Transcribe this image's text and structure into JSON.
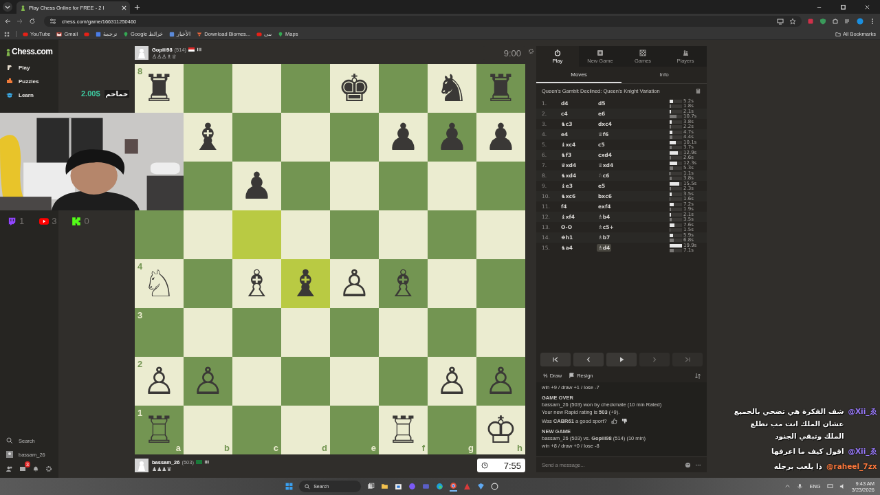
{
  "browser": {
    "tab_title": "Play Chess Online for FREE - 2 I",
    "url": "chess.com/game/166311250460",
    "bookmarks": [
      {
        "label": "YouTube",
        "kind": "youtube"
      },
      {
        "label": "Gmail",
        "kind": "gmail"
      },
      {
        "kind": "youtube"
      },
      {
        "label": "ترجمة",
        "kind": "translate"
      },
      {
        "label": "Google خرائط",
        "kind": "maps"
      },
      {
        "label": "الأخبار",
        "kind": "news"
      },
      {
        "label": "Download Biomes...",
        "kind": "download"
      },
      {
        "label": "ىىى",
        "kind": "youtube"
      },
      {
        "label": "Maps",
        "kind": "maps"
      }
    ],
    "all_bookmarks": "All Bookmarks"
  },
  "sidebar": {
    "logo": "Chess.com",
    "items": [
      {
        "label": "Play",
        "kind": "play"
      },
      {
        "label": "Puzzles",
        "kind": "puzzles"
      },
      {
        "label": "Learn",
        "kind": "learn"
      }
    ],
    "search": "Search",
    "user": "bassam_26",
    "mail_badge": "3"
  },
  "stream": {
    "donation_amount": "2.00$",
    "donation_name": "خماخم",
    "counts": [
      {
        "kind": "twitch",
        "count": "1"
      },
      {
        "kind": "youtube",
        "count": "3"
      },
      {
        "kind": "kick",
        "count": "0"
      }
    ],
    "chat": [
      {
        "user": "@Xii_ゑ",
        "color": "#9b7bff",
        "message": "شف الفكرة هي تضحي بالجميع عشان الملك انت مب تطلع الملك وتبقي الجنود"
      },
      {
        "user": "@Xii_ゑ",
        "color": "#9b7bff",
        "message": "اقول كيف ما اعرفها"
      },
      {
        "user": "@raheel_7zx",
        "color": "#ff7a3d",
        "message": "ذا يلعب برجله"
      }
    ]
  },
  "game": {
    "top_player": {
      "name": "Gopiii98",
      "rating": "(514)",
      "captured": "♙♙♙♗♕",
      "clock": "9:00",
      "active": false
    },
    "bottom_player": {
      "name": "bassam_26",
      "rating": "(503)",
      "captured": "♟♟♟♛",
      "clock": "7:55",
      "active": true
    },
    "board": {
      "files": [
        "a",
        "b",
        "c",
        "d",
        "e",
        "f",
        "g",
        "h"
      ],
      "ranks": [
        {
          "label": "8",
          "cells": [
            {
              "piece": "♜",
              "highlighted": false
            },
            {
              "highlighted": false
            },
            {
              "highlighted": false
            },
            {
              "highlighted": false
            },
            {
              "piece": "♚",
              "highlighted": false
            },
            {
              "highlighted": false
            },
            {
              "piece": "♞",
              "highlighted": false
            },
            {
              "piece": "♜",
              "highlighted": false
            }
          ]
        },
        {
          "cells": [
            {},
            {
              "piece": "♝",
              "highlighted": false
            },
            {
              "highlighted": false
            },
            {
              "highlighted": false
            },
            {
              "highlighted": false
            },
            {
              "piece": "♟",
              "highlighted": false
            },
            {
              "piece": "♟",
              "highlighted": false
            },
            {
              "piece": "♟",
              "highlighted": false
            }
          ]
        },
        {
          "cells": [
            {},
            {
              "highlighted": false
            },
            {
              "piece": "♟",
              "highlighted": false
            },
            {
              "highlighted": false
            },
            {
              "highlighted": false
            },
            {
              "highlighted": false
            },
            {
              "highlighted": false
            },
            {
              "highlighted": false
            }
          ]
        },
        {
          "cells": [
            {
              "highlighted": false
            },
            {
              "highlighted": false
            },
            {
              "highlighted": true
            },
            {
              "highlighted": false
            },
            {
              "highlighted": false
            },
            {
              "highlighted": false
            },
            {
              "highlighted": false
            },
            {
              "highlighted": false
            }
          ]
        },
        {
          "label": "4",
          "cells": [
            {
              "piece": "♘",
              "highlighted": false
            },
            {
              "highlighted": false
            },
            {
              "piece": "♗",
              "highlighted": false
            },
            {
              "piece": "♝",
              "highlighted": true
            },
            {
              "piece": "♙",
              "highlighted": false
            },
            {
              "piece": "♗",
              "highlighted": false
            },
            {
              "highlighted": false
            },
            {
              "highlighted": false
            }
          ]
        },
        {
          "label": "3",
          "cells": [
            {
              "highlighted": false
            },
            {
              "highlighted": false
            },
            {
              "highlighted": false
            },
            {
              "highlighted": false
            },
            {
              "highlighted": false
            },
            {
              "highlighted": false
            },
            {
              "highlighted": false
            },
            {
              "highlighted": false
            }
          ]
        },
        {
          "label": "2",
          "cells": [
            {
              "piece": "♙",
              "highlighted": false
            },
            {
              "piece": "♙",
              "highlighted": false
            },
            {
              "highlighted": false
            },
            {
              "highlighted": false
            },
            {
              "highlighted": false
            },
            {
              "highlighted": false
            },
            {
              "piece": "♙",
              "highlighted": false
            },
            {
              "piece": "♙",
              "highlighted": false
            }
          ]
        },
        {
          "label": "1",
          "cells": [
            {
              "piece": "♖",
              "highlighted": false
            },
            {
              "highlighted": false
            },
            {
              "highlighted": false
            },
            {
              "highlighted": false
            },
            {
              "highlighted": false
            },
            {
              "piece": "♖",
              "highlighted": false
            },
            {
              "highlighted": false
            },
            {
              "piece": "♔",
              "highlighted": false
            }
          ]
        }
      ]
    }
  },
  "panel": {
    "tabs": [
      {
        "label": "Play",
        "kind": "play",
        "selected": true
      },
      {
        "label": "New Game",
        "kind": "new",
        "selected": false
      },
      {
        "label": "Games",
        "kind": "games",
        "selected": false
      },
      {
        "label": "Players",
        "kind": "players",
        "selected": false
      }
    ],
    "subtabs": [
      {
        "label": "Moves",
        "selected": true
      },
      {
        "label": "Info",
        "selected": false
      }
    ],
    "opening": "Queen's Gambit Declined: Queen's Knight Variation",
    "moves": [
      {
        "number": "1.",
        "white": {
          "text": "d4",
          "time": "5.2s",
          "level": 0.26,
          "selected": false
        },
        "black": {
          "text": "d5",
          "time": "1.8s",
          "level": 0.09,
          "selected": false
        }
      },
      {
        "number": "2.",
        "white": {
          "text": "c4",
          "time": "2.1s",
          "level": 0.11,
          "selected": false
        },
        "black": {
          "text": "e6",
          "time": "10.7s",
          "level": 0.54,
          "selected": false
        }
      },
      {
        "number": "3.",
        "white": {
          "text": "♞c3",
          "time": "3.8s",
          "level": 0.19,
          "selected": false
        },
        "black": {
          "text": "dxc4",
          "time": "2.2s",
          "level": 0.11,
          "selected": false
        }
      },
      {
        "number": "4.",
        "white": {
          "text": "e4",
          "time": "4.7s",
          "level": 0.24,
          "selected": false
        },
        "black": {
          "text": "♕f6",
          "time": "4.4s",
          "level": 0.22,
          "selected": false
        }
      },
      {
        "number": "5.",
        "white": {
          "text": "♝xc4",
          "time": "10.1s",
          "level": 0.51,
          "selected": false
        },
        "black": {
          "text": "c5",
          "time": "3.7s",
          "level": 0.19,
          "selected": false
        }
      },
      {
        "number": "6.",
        "white": {
          "text": "♞f3",
          "time": "12.9s",
          "level": 0.65,
          "selected": false
        },
        "black": {
          "text": "cxd4",
          "time": "2.6s",
          "level": 0.13,
          "selected": false
        }
      },
      {
        "number": "7.",
        "white": {
          "text": "♛xd4",
          "time": "12.3s",
          "level": 0.62,
          "selected": false
        },
        "black": {
          "text": "♕xd4",
          "time": "5.3s",
          "level": 0.27,
          "selected": false
        }
      },
      {
        "number": "8.",
        "white": {
          "text": "♞xd4",
          "time": "1.1s",
          "level": 0.06,
          "selected": false
        },
        "black": {
          "text": "♘c6",
          "time": "3.8s",
          "level": 0.19,
          "selected": false
        }
      },
      {
        "number": "9.",
        "white": {
          "text": "♝e3",
          "time": "15.5s",
          "level": 0.78,
          "selected": false
        },
        "black": {
          "text": "e5",
          "time": "2.3s",
          "level": 0.12,
          "selected": false
        }
      },
      {
        "number": "10.",
        "white": {
          "text": "♞xc6",
          "time": "3.5s",
          "level": 0.18,
          "selected": false
        },
        "black": {
          "text": "bxc6",
          "time": "1.6s",
          "level": 0.08,
          "selected": false
        }
      },
      {
        "number": "11.",
        "white": {
          "text": "f4",
          "time": "7.2s",
          "level": 0.36,
          "selected": false
        },
        "black": {
          "text": "exf4",
          "time": "1.9s",
          "level": 0.1,
          "selected": false
        }
      },
      {
        "number": "12.",
        "white": {
          "text": "♝xf4",
          "time": "2.1s",
          "level": 0.11,
          "selected": false
        },
        "black": {
          "text": "♗b4",
          "time": "3.5s",
          "level": 0.18,
          "selected": false
        }
      },
      {
        "number": "13.",
        "white": {
          "text": "O-O",
          "time": "7.6s",
          "level": 0.38,
          "selected": false
        },
        "black": {
          "text": "♗c5+",
          "time": "1.5s",
          "level": 0.08,
          "selected": false
        }
      },
      {
        "number": "14.",
        "white": {
          "text": "♚h1",
          "time": "5.9s",
          "level": 0.3,
          "selected": false
        },
        "black": {
          "text": "♗b7",
          "time": "6.8s",
          "level": 0.34,
          "selected": false
        }
      },
      {
        "number": "15.",
        "white": {
          "text": "♞a4",
          "time": "19.9s",
          "level": 1,
          "selected": false
        },
        "black": {
          "text": "♗d4",
          "time": "7.1s",
          "level": 0.36,
          "selected": true
        }
      }
    ],
    "nav": [
      {
        "kind": "first",
        "disabled": false
      },
      {
        "kind": "prev",
        "disabled": false
      },
      {
        "kind": "play",
        "disabled": false
      },
      {
        "kind": "next",
        "disabled": true
      },
      {
        "kind": "last",
        "disabled": true
      }
    ],
    "actions": [
      {
        "kind": "draw",
        "icon": "½",
        "label": "Draw"
      },
      {
        "kind": "resign",
        "label": "Resign"
      }
    ],
    "chat": [
      {
        "kind": "line",
        "text": "win +9 / draw +1 / lose -7"
      },
      {
        "kind": "heading",
        "text": "GAME OVER"
      },
      {
        "kind": "line",
        "text": "bassam_26 (503) won by checkmate (10 min Rated)"
      },
      {
        "kind": "line",
        "text": "Your new Rapid rating is **503** (+9)."
      },
      {
        "kind": "sport",
        "text": "Was **CABR61** a good sport?"
      },
      {
        "kind": "heading",
        "text": "NEW GAME"
      },
      {
        "kind": "line",
        "text": "bassam_26 (503) vs. **Gopiii98** (514) (10 min)"
      },
      {
        "kind": "line",
        "text": "win +8 / draw +0 / lose -8"
      }
    ],
    "chat_placeholder": "Send a message..."
  },
  "taskbar": {
    "search": "Search",
    "language": "ENG",
    "time": "9:43 AM",
    "date": "3/23/2026"
  }
}
